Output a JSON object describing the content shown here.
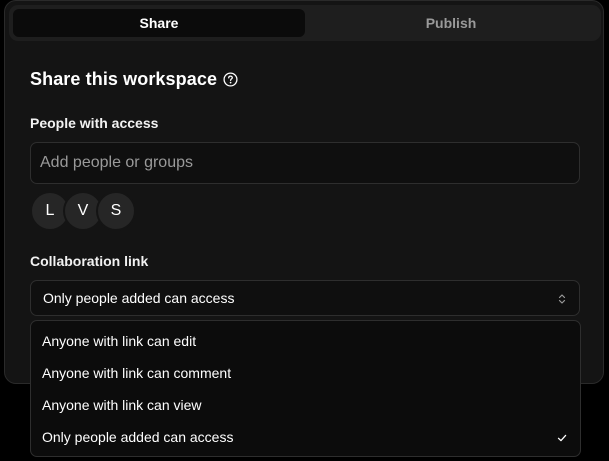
{
  "tabs": [
    {
      "label": "Share",
      "active": true
    },
    {
      "label": "Publish",
      "active": false
    }
  ],
  "panel": {
    "title": "Share this workspace",
    "people_label": "People with access",
    "search_placeholder": "Add people or groups",
    "avatars": [
      "L",
      "V",
      "S"
    ],
    "collab_label": "Collaboration link",
    "selected_option": "Only people added can access"
  },
  "dropdown": {
    "options": [
      "Anyone with link can edit",
      "Anyone with link can comment",
      "Anyone with link can view",
      "Only people added can access"
    ],
    "checked_index": 3
  },
  "icons": {
    "help": "question-circle-icon",
    "select": "chevron-up-down-icon",
    "check": "check-icon"
  },
  "colors": {
    "background": "#141414",
    "tab_active": "#0b0b0b",
    "tab_inactive_text": "#9a9a9a",
    "border": "#2e2e2e"
  }
}
